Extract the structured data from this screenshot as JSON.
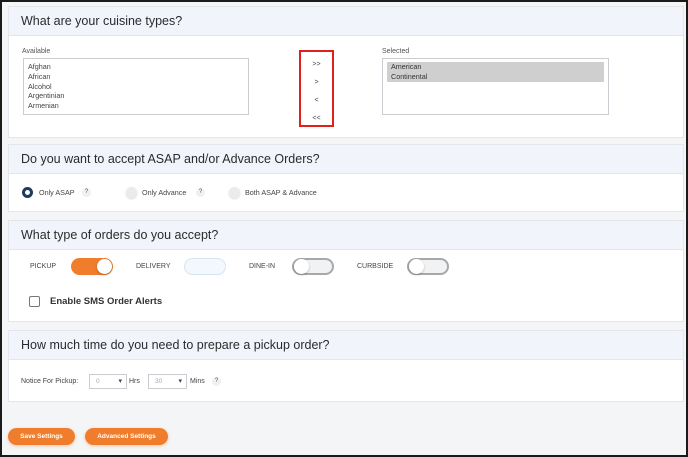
{
  "cuisine": {
    "title": "What are your cuisine types?",
    "available_label": "Available",
    "available_items": [
      "Afghan",
      "African",
      "Alcohol",
      "Argentinian",
      "Armenian"
    ],
    "selected_label": "Selected",
    "selected_items": [
      "American",
      "Continental"
    ],
    "move_buttons": [
      ">>",
      ">",
      "<",
      "<<"
    ]
  },
  "order_mode": {
    "title": "Do you want to accept ASAP and/or Advance Orders?",
    "options": [
      {
        "label": "Only ASAP",
        "checked": true,
        "help": "?"
      },
      {
        "label": "Only Advance",
        "checked": false,
        "help": "?"
      },
      {
        "label": "Both ASAP & Advance",
        "checked": false
      }
    ]
  },
  "order_types": {
    "title": "What type of orders do you accept?",
    "types": [
      {
        "label": "PICKUP",
        "enabled": true
      },
      {
        "label": "DELIVERY",
        "enabled": false
      },
      {
        "label": "DINE-IN",
        "enabled": false
      },
      {
        "label": "CURBSIDE",
        "enabled": false
      }
    ],
    "sms_label": "Enable SMS Order Alerts",
    "sms_checked": false
  },
  "prep_time": {
    "title": "How much time do you need to prepare a pickup order?",
    "notice_label": "Notice For Pickup:",
    "hours_value": "0",
    "hours_unit": "Hrs",
    "minutes_value": "30",
    "minutes_unit": "Mins",
    "help": "?"
  },
  "footer": {
    "save_label": "Save Settings",
    "advanced_label": "Advanced Settings"
  },
  "colors": {
    "accent": "#f07d2b",
    "highlight_border": "#e0201b",
    "radio_on": "#1f3a5f"
  }
}
